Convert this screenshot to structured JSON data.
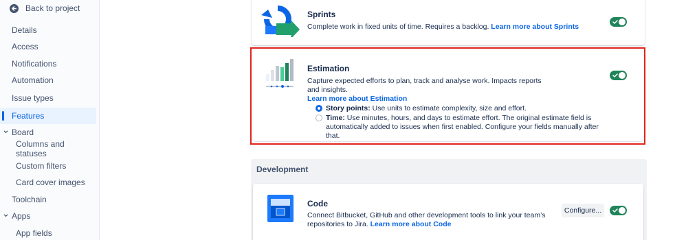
{
  "sidebar": {
    "back_label": "Back to project",
    "items": [
      {
        "label": "Details"
      },
      {
        "label": "Access"
      },
      {
        "label": "Notifications"
      },
      {
        "label": "Automation"
      },
      {
        "label": "Issue types"
      },
      {
        "label": "Features"
      },
      {
        "label": "Board"
      },
      {
        "label": "Columns and statuses"
      },
      {
        "label": "Custom filters"
      },
      {
        "label": "Card cover images"
      },
      {
        "label": "Toolchain"
      },
      {
        "label": "Apps"
      },
      {
        "label": "App fields"
      }
    ],
    "active_item": "Features"
  },
  "sprints": {
    "title": "Sprints",
    "description": "Complete work in fixed units of time. Requires a backlog.",
    "link": "Learn more about Sprints",
    "enabled": true
  },
  "estimation": {
    "title": "Estimation",
    "description": "Capture expected efforts to plan, track and analyse work. Impacts reports and insights.",
    "link": "Learn more about Estimation",
    "enabled": true,
    "options": [
      {
        "label": "Story points:",
        "text": "Use units to estimate complexity, size and effort.",
        "selected": true
      },
      {
        "label": "Time:",
        "text": "Use minutes, hours, and days to estimate effort. The original estimate field is automatically added to issues when first enabled. Configure your fields manually after that.",
        "selected": false
      }
    ]
  },
  "development": {
    "section_title": "Development"
  },
  "code": {
    "title": "Code",
    "description": "Connect Bitbucket, GitHub and other development tools to link your team’s repositories to Jira.",
    "link": "Learn more about Code",
    "configure_label": "Configure...",
    "enabled": true
  },
  "colors": {
    "accent": "#0c66e4",
    "toggle_on": "#1f845a",
    "highlight": "#e2231a"
  }
}
